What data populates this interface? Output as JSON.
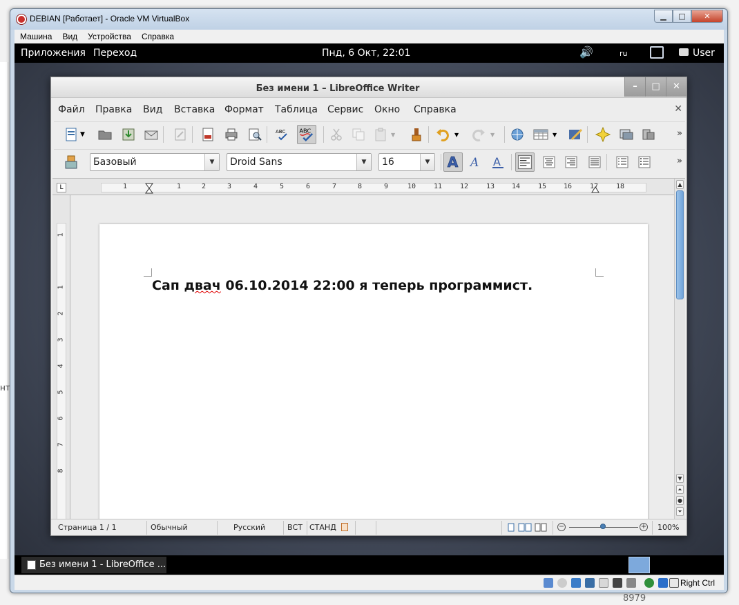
{
  "host": {
    "left_fragment": "нт",
    "bottom_number": "8979"
  },
  "vbox": {
    "title": "DEBIAN [Работает] - Oracle VM VirtualBox",
    "menu": [
      "Машина",
      "Вид",
      "Устройства",
      "Справка"
    ],
    "window_buttons": {
      "minimize": "▁",
      "maximize": "□",
      "close": "✕"
    },
    "status": {
      "host_key": "Right Ctrl"
    }
  },
  "gnome_panel": {
    "applications": "Приложения",
    "places": "Переход",
    "clock": "Пнд,  6 Окт, 22:01",
    "volume_icon": "speaker-icon",
    "lang": "ru",
    "user": "User"
  },
  "writer": {
    "title": "Без имени 1 – LibreOffice Writer",
    "window_controls": {
      "minimize": "–",
      "maximize": "□",
      "close": "✕"
    },
    "menu": [
      {
        "label": "Файл"
      },
      {
        "label": "Правка"
      },
      {
        "label": "Вид"
      },
      {
        "label": "Вставка"
      },
      {
        "label": "Формат"
      },
      {
        "label": "Таблица"
      },
      {
        "label": "Сервис"
      },
      {
        "label": "Окно"
      },
      {
        "label": "Справка"
      }
    ],
    "menu_close": "✕",
    "formatting": {
      "paragraph_style": "Базовый",
      "font_name": "Droid Sans",
      "font_size": "16",
      "bold_active": true,
      "align_left_active": true
    },
    "ruler": {
      "h_numbers": [
        "1",
        "1",
        "2",
        "3",
        "4",
        "5",
        "6",
        "7",
        "8",
        "9",
        "10",
        "11",
        "12",
        "13",
        "14",
        "15",
        "16",
        "17",
        "18"
      ],
      "v_numbers": [
        "1",
        "1",
        "2",
        "3",
        "4",
        "5",
        "6",
        "7",
        "8"
      ],
      "corner_symbol": "L"
    },
    "document": {
      "text_before": "Сап ",
      "text_misspelled": "двач",
      "text_after": " 06.10.2014 22:00 я теперь программист."
    },
    "status": {
      "page": "Страница 1 / 1",
      "page_style": "Обычный",
      "language": "Русский",
      "insert_mode": "ВСТ",
      "selection_mode": "СТАНД",
      "zoom": "100%"
    },
    "toolbar_more": "»"
  },
  "taskbar": {
    "task_label": "Без имени 1 - LibreOffice ..."
  }
}
